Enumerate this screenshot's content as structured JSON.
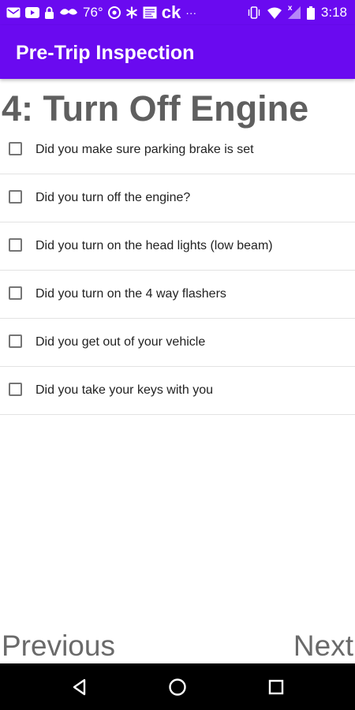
{
  "status_bar": {
    "temperature": "76°",
    "time": "3:18",
    "brand_text": "ck",
    "overflow": "···",
    "signal_badge": "x",
    "icons": [
      "mail-icon",
      "youtube-icon",
      "lock-icon",
      "mustache-icon",
      "chrome-icon",
      "asterisk-icon",
      "news-icon",
      "vibrate-icon",
      "wifi-icon",
      "signal-icon",
      "battery-icon"
    ]
  },
  "app_bar": {
    "title": "Pre-Trip Inspection",
    "color": "#6a0af0"
  },
  "step": {
    "heading": "4: Turn Off Engine"
  },
  "checklist": {
    "items": [
      {
        "label": "Did you make sure parking brake is set",
        "checked": false
      },
      {
        "label": "Did you turn off the engine?",
        "checked": false
      },
      {
        "label": "Did you turn on the head lights (low beam)",
        "checked": false
      },
      {
        "label": "Did you turn on the 4 way flashers",
        "checked": false
      },
      {
        "label": "Did you get out of your vehicle",
        "checked": false
      },
      {
        "label": "Did you take your keys with you",
        "checked": false
      }
    ]
  },
  "footer_nav": {
    "previous_label": "Previous",
    "next_label": "Next"
  },
  "system_nav": {
    "icons": [
      "back-icon",
      "home-icon",
      "recents-icon"
    ]
  }
}
